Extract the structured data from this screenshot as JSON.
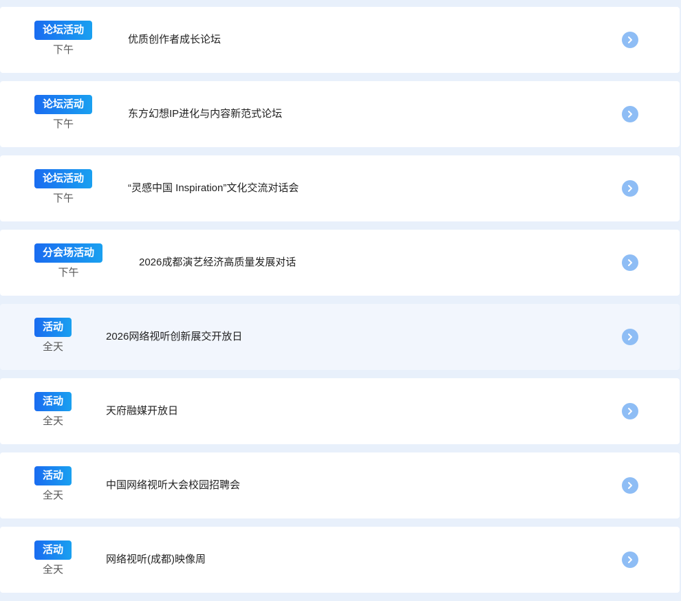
{
  "items": [
    {
      "tag": "论坛活动",
      "time": "下午",
      "title": "优质创作者成长论坛"
    },
    {
      "tag": "论坛活动",
      "time": "下午",
      "title": "东方幻想IP进化与内容新范式论坛"
    },
    {
      "tag": "论坛活动",
      "time": "下午",
      "title": "“灵感中国 Inspiration”文化交流对话会"
    },
    {
      "tag": "分会场活动",
      "time": "下午",
      "title": "2026成都演艺经济高质量发展对话"
    },
    {
      "tag": "活动",
      "time": "全天",
      "title": "2026网络视听创新展交开放日"
    },
    {
      "tag": "活动",
      "time": "全天",
      "title": "天府融媒开放日"
    },
    {
      "tag": "活动",
      "time": "全天",
      "title": "中国网络视听大会校园招聘会"
    },
    {
      "tag": "活动",
      "time": "全天",
      "title": "网络视听(成都)映像周"
    }
  ],
  "colors": {
    "page_bg": "#e8f0fb",
    "card_bg": "#ffffff",
    "card_highlight_bg": "#f2f6fd",
    "tag_gradient_start": "#1a6cf0",
    "tag_gradient_end": "#1aa0f0",
    "arrow_circle": "#8ebdf5"
  },
  "icons": {
    "card_action": "chevron-right-circle-icon"
  }
}
